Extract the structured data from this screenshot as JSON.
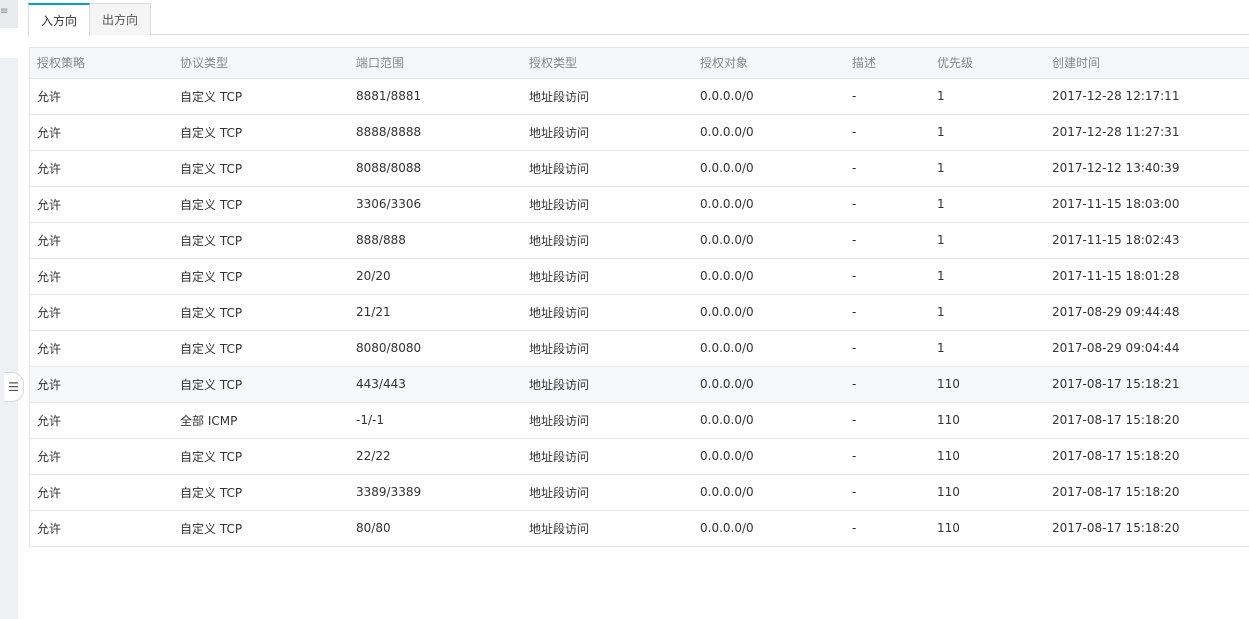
{
  "tabs": [
    {
      "label": "入方向",
      "active": true
    },
    {
      "label": "出方向",
      "active": false
    }
  ],
  "table": {
    "columns": [
      "授权策略",
      "协议类型",
      "端口范围",
      "授权类型",
      "授权对象",
      "描述",
      "优先级",
      "创建时间"
    ],
    "rows": [
      [
        "允许",
        "自定义 TCP",
        "8881/8881",
        "地址段访问",
        "0.0.0.0/0",
        "-",
        "1",
        "2017-12-28 12:17:11"
      ],
      [
        "允许",
        "自定义 TCP",
        "8888/8888",
        "地址段访问",
        "0.0.0.0/0",
        "-",
        "1",
        "2017-12-28 11:27:31"
      ],
      [
        "允许",
        "自定义 TCP",
        "8088/8088",
        "地址段访问",
        "0.0.0.0/0",
        "-",
        "1",
        "2017-12-12 13:40:39"
      ],
      [
        "允许",
        "自定义 TCP",
        "3306/3306",
        "地址段访问",
        "0.0.0.0/0",
        "-",
        "1",
        "2017-11-15 18:03:00"
      ],
      [
        "允许",
        "自定义 TCP",
        "888/888",
        "地址段访问",
        "0.0.0.0/0",
        "-",
        "1",
        "2017-11-15 18:02:43"
      ],
      [
        "允许",
        "自定义 TCP",
        "20/20",
        "地址段访问",
        "0.0.0.0/0",
        "-",
        "1",
        "2017-11-15 18:01:28"
      ],
      [
        "允许",
        "自定义 TCP",
        "21/21",
        "地址段访问",
        "0.0.0.0/0",
        "-",
        "1",
        "2017-08-29 09:44:48"
      ],
      [
        "允许",
        "自定义 TCP",
        "8080/8080",
        "地址段访问",
        "0.0.0.0/0",
        "-",
        "1",
        "2017-08-29 09:04:44"
      ],
      [
        "允许",
        "自定义 TCP",
        "443/443",
        "地址段访问",
        "0.0.0.0/0",
        "-",
        "110",
        "2017-08-17 15:18:21"
      ],
      [
        "允许",
        "全部 ICMP",
        "-1/-1",
        "地址段访问",
        "0.0.0.0/0",
        "-",
        "110",
        "2017-08-17 15:18:20"
      ],
      [
        "允许",
        "自定义 TCP",
        "22/22",
        "地址段访问",
        "0.0.0.0/0",
        "-",
        "110",
        "2017-08-17 15:18:20"
      ],
      [
        "允许",
        "自定义 TCP",
        "3389/3389",
        "地址段访问",
        "0.0.0.0/0",
        "-",
        "110",
        "2017-08-17 15:18:20"
      ],
      [
        "允许",
        "自定义 TCP",
        "80/80",
        "地址段访问",
        "0.0.0.0/0",
        "-",
        "110",
        "2017-08-17 15:18:20"
      ]
    ],
    "highlighted_row": 8
  },
  "icons": {
    "collapse_handle": "list-collapse-icon",
    "corner": "menu-icon"
  },
  "colors": {
    "accent": "#00a2ca",
    "header_bg": "#f5f6f7",
    "header_text": "#888888",
    "border": "#e5e5e5"
  }
}
